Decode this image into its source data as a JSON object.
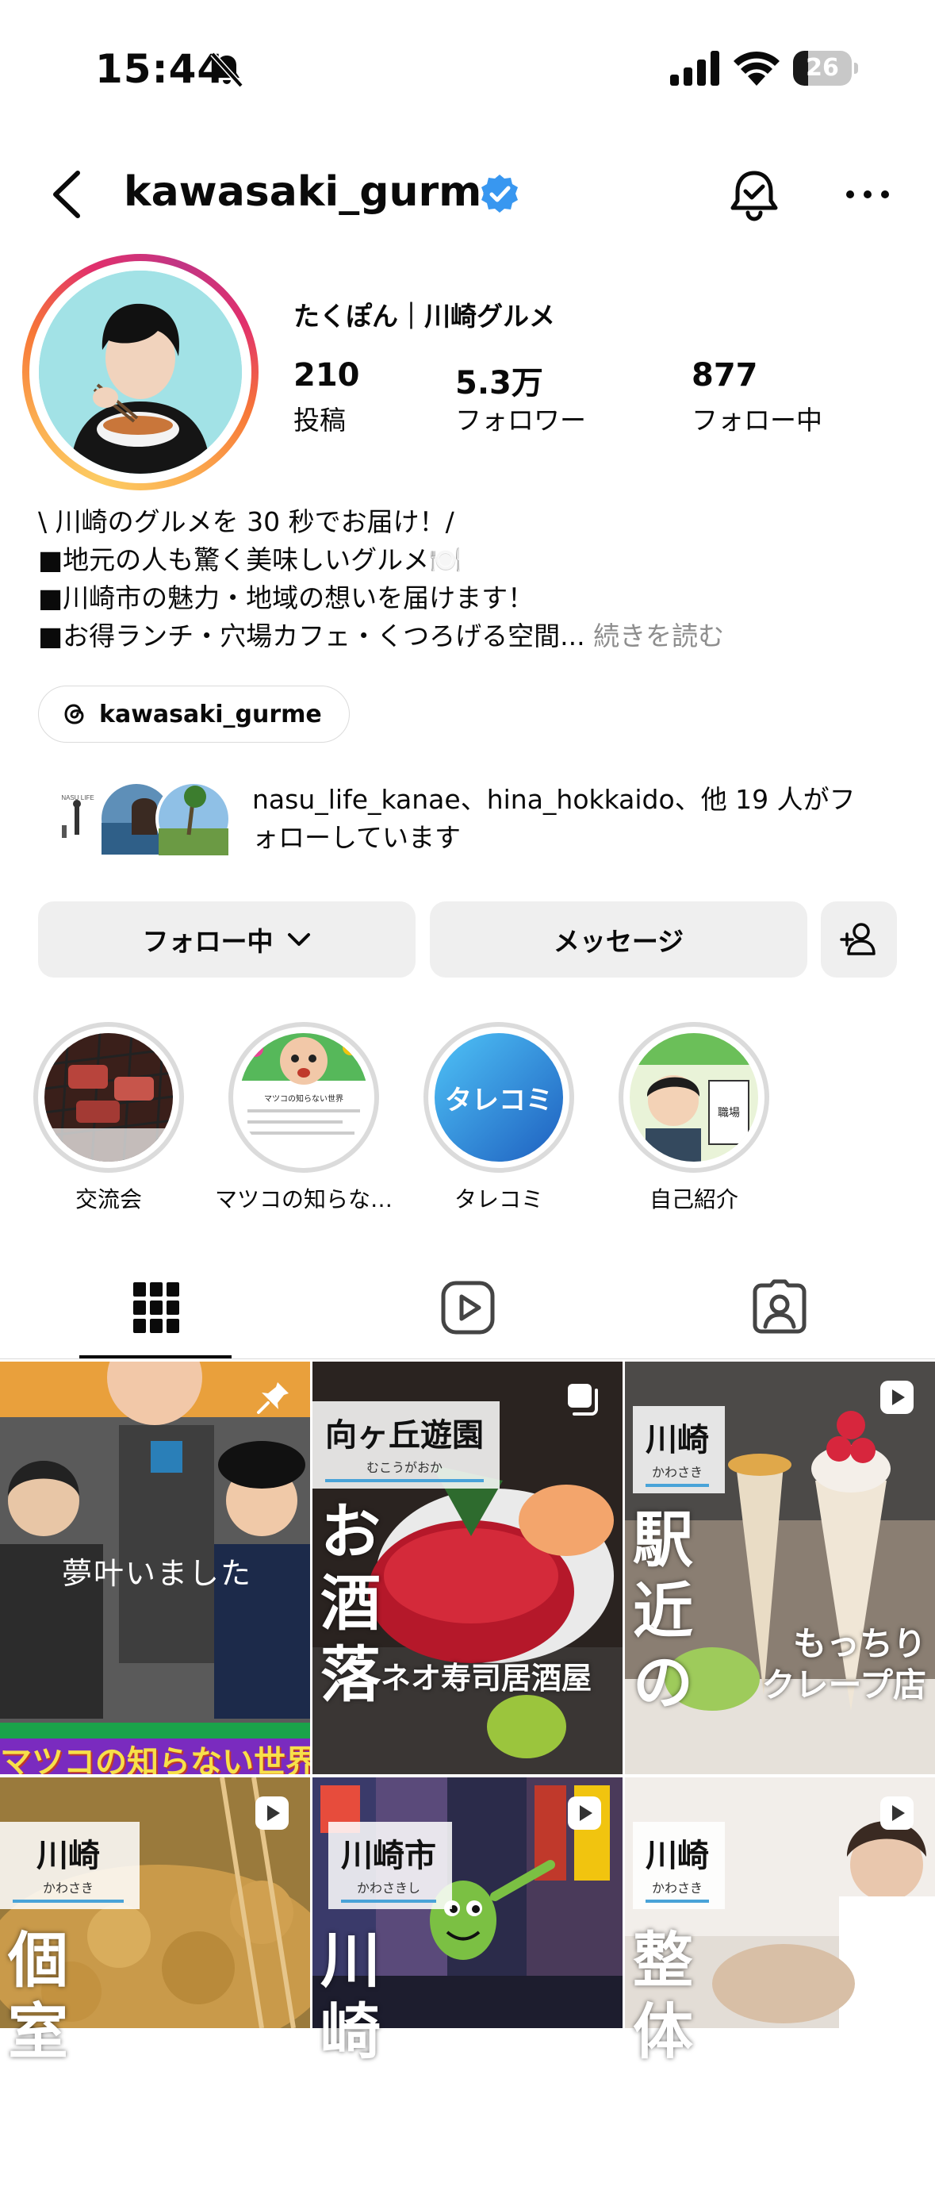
{
  "status_bar": {
    "time": "15:44",
    "battery": "26",
    "battery_level": 0.26
  },
  "header": {
    "username": "kawasaki_gurme"
  },
  "profile": {
    "display_name": "たくぽん｜川崎グルメ",
    "stats": [
      {
        "value": "210",
        "label": "投稿"
      },
      {
        "value": "5.3万",
        "label": "フォロワー"
      },
      {
        "value": "877",
        "label": "フォロー中"
      }
    ],
    "bio_lines": [
      "\\ 川崎のグルメを 30 秒でお届け！/",
      "■地元の人も驚く美味しいグルメ🍽️",
      "■川崎市の魅力・地域の想いを届けます！",
      "■お得ランチ・穴場カフェ・くつろげる空間..."
    ],
    "bio_more": "続きを読む",
    "threads_handle": "kawasaki_gurme",
    "mutual_text_line1": "nasu_life_kanae、hina_hokkaido、他 19 人がフ",
    "mutual_text_line2": "ォローしています",
    "mutual_avatar_text": "NASU LIFE"
  },
  "buttons": {
    "following": "フォロー中",
    "message": "メッセージ"
  },
  "highlights": [
    {
      "label": "交流会",
      "inner_text": ""
    },
    {
      "label": "マツコの知らな…",
      "inner_text": "マツコの知らない世界"
    },
    {
      "label": "タレコミ",
      "inner_text": "タレコミ"
    },
    {
      "label": "自己紹介",
      "inner_text": "職場"
    }
  ],
  "posts": [
    {
      "overlay": "夢叶いました",
      "banner": "マツコの知らない世界"
    },
    {
      "title": "向ヶ丘遊園",
      "reading": "むこうがおか",
      "big": "お酒落",
      "caption": "ネオ寿司居酒屋"
    },
    {
      "title": "川崎",
      "reading": "かわさき",
      "big": "駅近の",
      "caption_line1": "もっちり",
      "caption_line2": "クレープ店"
    },
    {
      "title": "川崎",
      "reading": "かわさき",
      "big": "個室"
    },
    {
      "title": "川崎市",
      "reading": "かわさきし",
      "big": "川崎"
    },
    {
      "title": "川崎",
      "reading": "かわさき",
      "big": "整体"
    }
  ]
}
